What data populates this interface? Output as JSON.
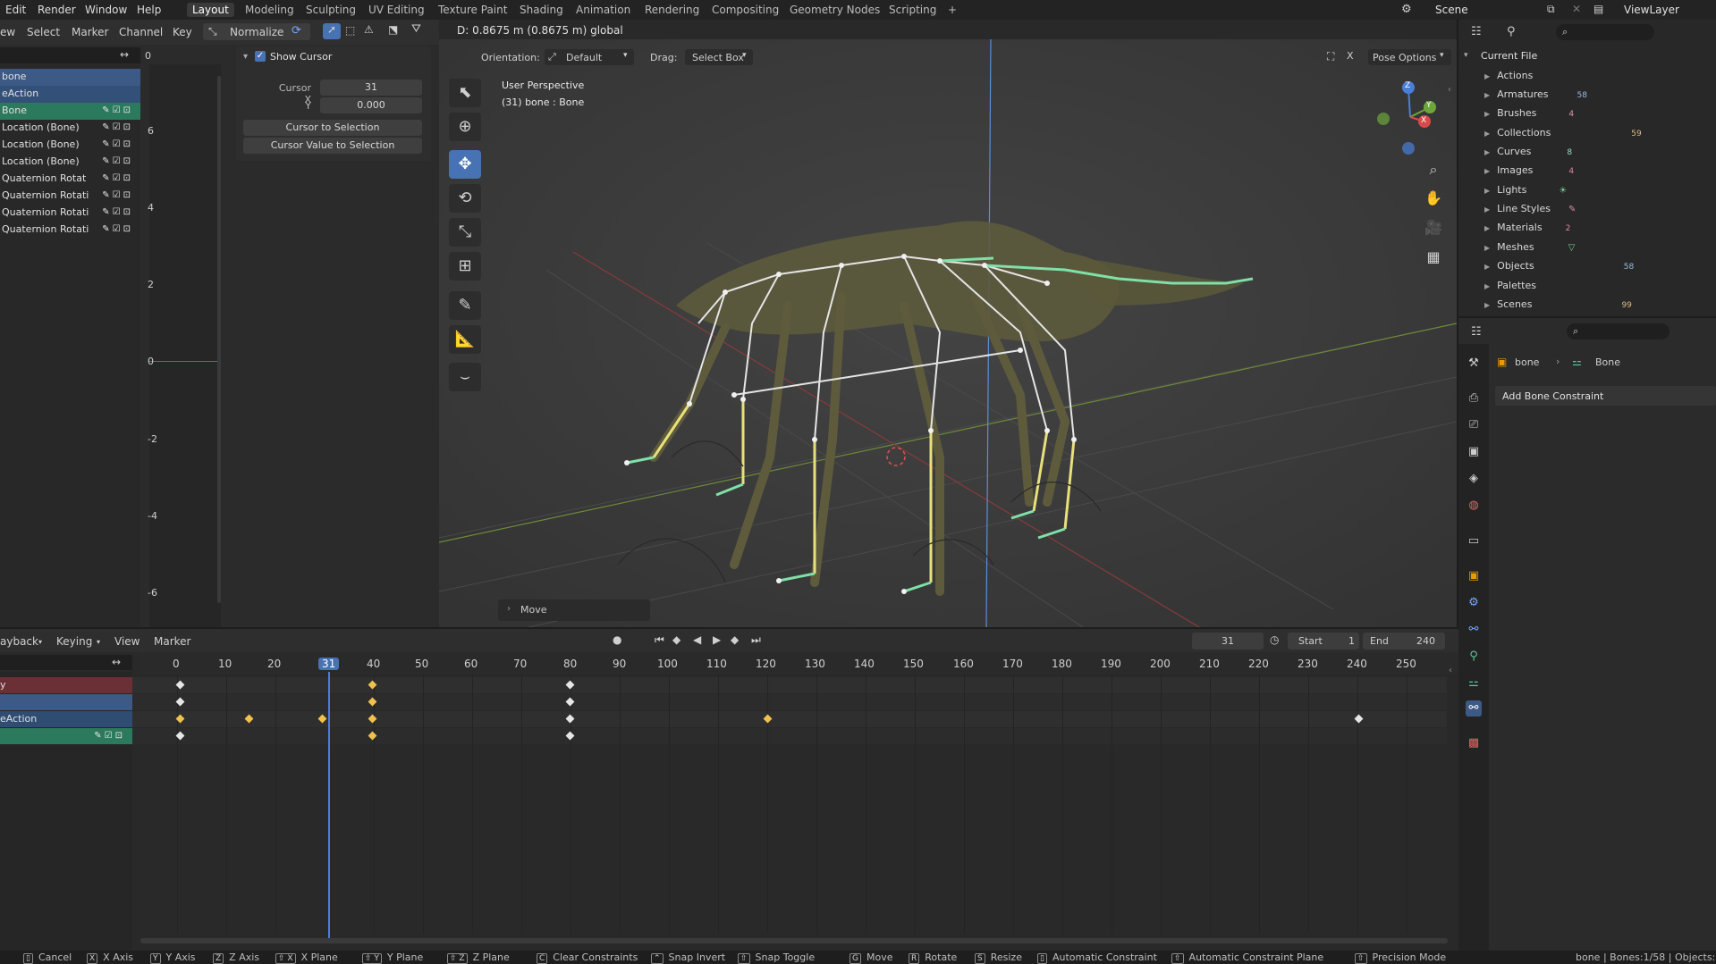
{
  "top_menu": [
    "Edit",
    "Render",
    "Window",
    "Help"
  ],
  "workspaces": [
    "Layout",
    "Modeling",
    "Sculpting",
    "UV Editing",
    "Texture Paint",
    "Shading",
    "Animation",
    "Rendering",
    "Compositing",
    "Geometry Nodes",
    "Scripting",
    "+"
  ],
  "scene": "Scene",
  "view_layer": "ViewLayer",
  "graph_editor": {
    "menus": [
      "ew",
      "Select",
      "Marker",
      "Channel",
      "Key"
    ],
    "normalize": "Normalize",
    "frame_field": "0",
    "channels": [
      {
        "label": "bone",
        "style": "blue-selected"
      },
      {
        "label": "eAction",
        "style": "blue"
      },
      {
        "label": "Bone",
        "style": "green"
      },
      {
        "label": "Location (Bone)"
      },
      {
        "label": "Location (Bone)"
      },
      {
        "label": "Location (Bone)"
      },
      {
        "label": "Quaternion Rotat"
      },
      {
        "label": "Quaternion Rotati"
      },
      {
        "label": "Quaternion Rotati"
      },
      {
        "label": "Quaternion Rotati"
      }
    ],
    "y_labels": [
      "6",
      "4",
      "2",
      "0",
      "-2",
      "-4",
      "-6"
    ],
    "cursor_panel": {
      "title": "Show Cursor",
      "cursor_x_label": "Cursor X",
      "cursor_x": "31",
      "y_label": "Y",
      "y_value": "0.000",
      "btn_to_selection": "Cursor to Selection",
      "btn_value_to_selection": "Cursor Value to Selection"
    }
  },
  "viewport": {
    "header_info": "D: 0.8675 m (0.8675 m) global",
    "orientation_label": "Orientation:",
    "orientation_value": "Default",
    "drag_label": "Drag:",
    "drag_value": "Select Box",
    "pose_options": "Pose Options",
    "view_name": "User Perspective",
    "object_info": "(31) bone : Bone",
    "last_op": "Move",
    "gizmo_labels": [
      "Z",
      "Y",
      "X"
    ]
  },
  "outliner": {
    "root": "Current File",
    "items": [
      {
        "label": "Actions"
      },
      {
        "label": "Armatures",
        "count": "58"
      },
      {
        "label": "Brushes",
        "count": "4"
      },
      {
        "label": "Collections",
        "count": "59"
      },
      {
        "label": "Curves",
        "count": "8"
      },
      {
        "label": "Images",
        "count": "4"
      },
      {
        "label": "Lights"
      },
      {
        "label": "Line Styles"
      },
      {
        "label": "Materials",
        "count": "2"
      },
      {
        "label": "Meshes"
      },
      {
        "label": "Objects",
        "count": "58"
      },
      {
        "label": "Palettes"
      },
      {
        "label": "Scenes",
        "count": "99"
      }
    ]
  },
  "properties": {
    "breadcrumb_object": "bone",
    "breadcrumb_bone": "Bone",
    "add_constraint": "Add Bone Constraint"
  },
  "timeline": {
    "menus": [
      "ayback",
      "Keying",
      "View",
      "Marker"
    ],
    "current_frame": "31",
    "start_label": "Start",
    "start": "1",
    "end_label": "End",
    "end": "240",
    "ticks": [
      "0",
      "10",
      "20",
      "31",
      "40",
      "50",
      "60",
      "70",
      "80",
      "90",
      "100",
      "110",
      "120",
      "130",
      "140",
      "150",
      "160",
      "170",
      "180",
      "190",
      "200",
      "210",
      "220",
      "230",
      "240",
      "250"
    ],
    "channels": [
      {
        "label": "y",
        "style": "red"
      },
      {
        "label": "",
        "style": "blue"
      },
      {
        "label": "eAction",
        "style": "blue-dark"
      },
      {
        "label": "",
        "style": "green"
      }
    ]
  },
  "status_bar": {
    "items": [
      {
        "key": "",
        "label": "Cancel"
      },
      {
        "key": "X",
        "label": "X Axis"
      },
      {
        "key": "Y",
        "label": "Y Axis"
      },
      {
        "key": "Z",
        "label": "Z Axis"
      },
      {
        "key": "⇧ X",
        "label": "X Plane"
      },
      {
        "key": "⇧ Y",
        "label": "Y Plane"
      },
      {
        "key": "⇧ Z",
        "label": "Z Plane"
      },
      {
        "key": "C",
        "label": "Clear Constraints"
      },
      {
        "key": "",
        "label": "Snap Invert"
      },
      {
        "key": "⇧",
        "label": "Snap Toggle"
      },
      {
        "key": "G",
        "label": "Move"
      },
      {
        "key": "R",
        "label": "Rotate"
      },
      {
        "key": "S",
        "label": "Resize"
      },
      {
        "key": "",
        "label": "Automatic Constraint"
      },
      {
        "key": "⇧",
        "label": "Automatic Constraint Plane"
      },
      {
        "key": "⇧",
        "label": "Precision Mode"
      }
    ],
    "right_info": "bone | Bones:1/58 | Objects:"
  },
  "colors": {
    "selection_blue": "#4772b3",
    "green_channel": "#2c8f6e",
    "keyframe_yellow": "#f0c14b",
    "cursor_line": "#5a8fd8"
  }
}
